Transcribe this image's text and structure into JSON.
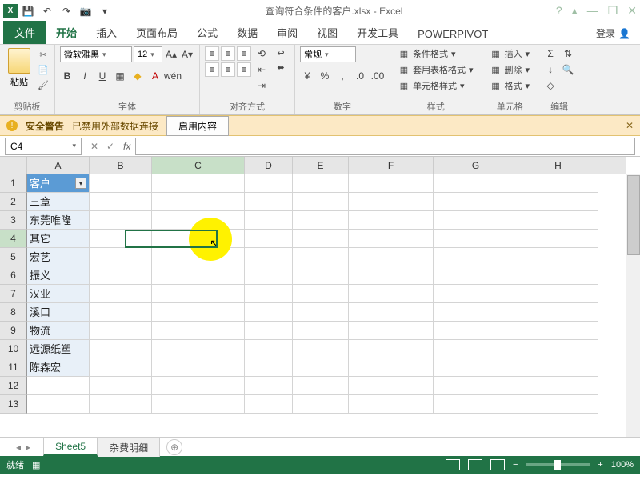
{
  "title": "查询符合条件的客户.xlsx - Excel",
  "qat": {
    "save": "💾",
    "undo": "↶",
    "redo": "↷",
    "camera": "📷",
    "more": "▾"
  },
  "win": {
    "help": "?",
    "ribbon": "▴",
    "min": "—",
    "restore": "❐",
    "close": "✕"
  },
  "tabs": {
    "file": "文件",
    "home": "开始",
    "insert": "插入",
    "layout": "页面布局",
    "formulas": "公式",
    "data": "数据",
    "review": "审阅",
    "view": "视图",
    "dev": "开发工具",
    "powerpivot": "POWERPIVOT",
    "login": "登录"
  },
  "ribbon": {
    "clipboard": {
      "paste": "粘贴",
      "label": "剪贴板"
    },
    "font": {
      "name": "微软雅黑",
      "size": "12",
      "label": "字体",
      "bold": "B",
      "italic": "I",
      "underline": "U"
    },
    "align": {
      "label": "对齐方式",
      "wrap": "自动换行",
      "merge": "合并后居中"
    },
    "number": {
      "general": "常规",
      "label": "数字"
    },
    "styles": {
      "cond": "条件格式",
      "table": "套用表格格式",
      "cell": "单元格样式",
      "label": "样式"
    },
    "cells": {
      "insert": "插入",
      "delete": "删除",
      "format": "格式",
      "label": "单元格"
    },
    "editing": {
      "sum": "Σ",
      "fill": "↓",
      "clear": "◇",
      "label": "编辑"
    }
  },
  "security": {
    "title": "安全警告",
    "msg": "已禁用外部数据连接",
    "enable": "启用内容"
  },
  "nameBox": "C4",
  "columns": [
    "A",
    "B",
    "C",
    "D",
    "E",
    "F",
    "G",
    "H"
  ],
  "rows": [
    "1",
    "2",
    "3",
    "4",
    "5",
    "6",
    "7",
    "8",
    "9",
    "10",
    "11",
    "12",
    "13"
  ],
  "dataA": [
    "客户",
    "三章",
    "东莞唯隆",
    "其它",
    "宏艺",
    "振义",
    "汉业",
    "溪口",
    "物流",
    "远源纸塑",
    "陈森宏",
    "",
    ""
  ],
  "sheets": {
    "s1": "Sheet5",
    "s2": "杂费明细"
  },
  "status": {
    "ready": "就绪",
    "rec": "▦",
    "zoom": "100%"
  }
}
